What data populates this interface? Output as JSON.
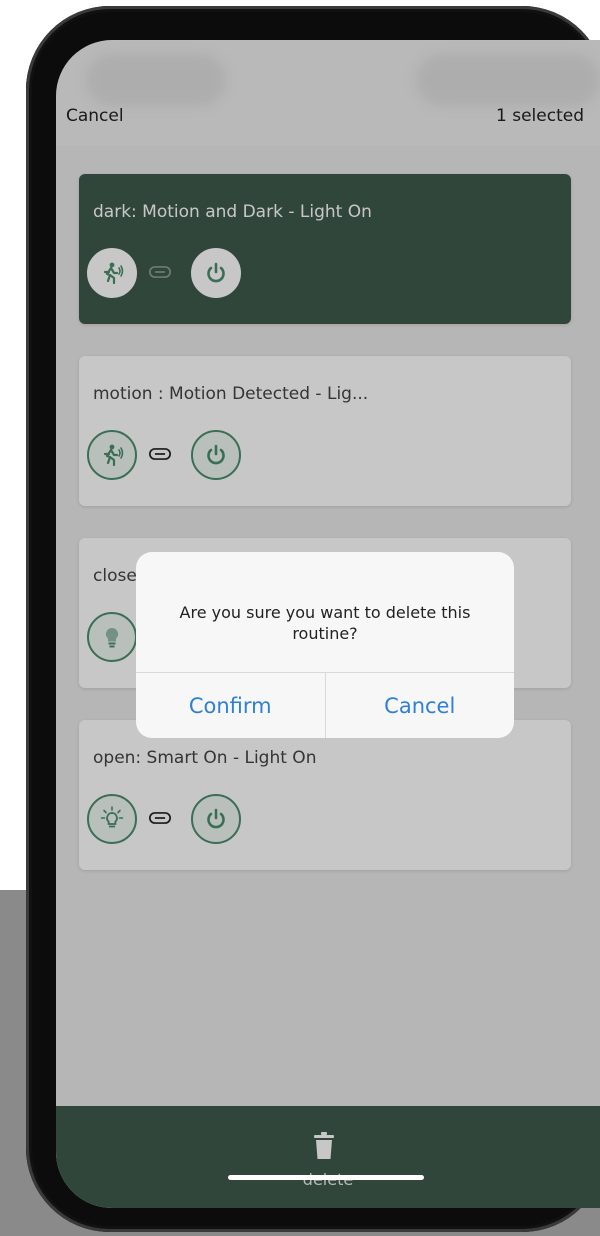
{
  "header": {
    "cancel_label": "Cancel",
    "selected_label": "1 selected"
  },
  "routines": [
    {
      "title": "dark: Motion and Dark - Light On",
      "selected": true,
      "trigger_icon": "motion-sensor-icon",
      "action_icon": "power-icon"
    },
    {
      "title": "motion : Motion Detected - Lig...",
      "selected": false,
      "trigger_icon": "motion-sensor-icon",
      "action_icon": "power-icon"
    },
    {
      "title": "close",
      "selected": false,
      "trigger_icon": "light-bulb-off-icon",
      "action_icon": "power-icon"
    },
    {
      "title": "open: Smart On - Light On",
      "selected": false,
      "trigger_icon": "light-bulb-on-icon",
      "action_icon": "power-icon"
    }
  ],
  "dialog": {
    "message": "Are you sure you want to delete this routine?",
    "confirm_label": "Confirm",
    "cancel_label": "Cancel"
  },
  "bottom_bar": {
    "delete_label": "delete"
  },
  "colors": {
    "accent_green": "#3f5a4b",
    "icon_green": "#4b8d6e",
    "link_blue": "#2f7fd9"
  }
}
